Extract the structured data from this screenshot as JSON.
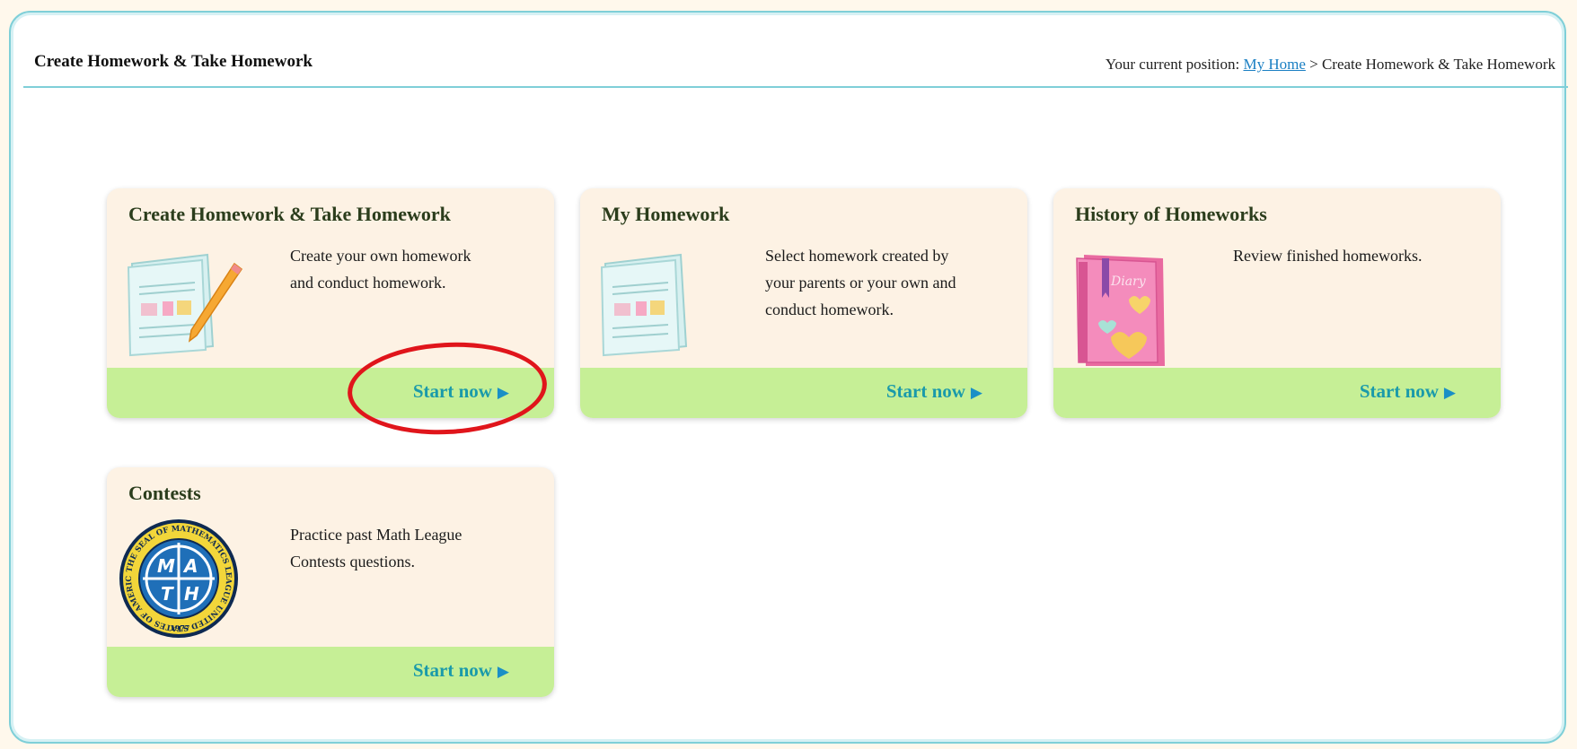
{
  "header": {
    "title": "Create Homework & Take Homework",
    "breadcrumb_prefix": "Your current position:",
    "breadcrumb_link": "My Home",
    "breadcrumb_separator": ">",
    "breadcrumb_current": "Create Homework & Take Homework"
  },
  "cards": [
    {
      "title": "Create Homework & Take Homework",
      "desc_line1": "Create your own homework",
      "desc_line2": "and conduct homework.",
      "button": "Start now",
      "icon": "homework-sheet-with-pencil-icon"
    },
    {
      "title": "My Homework",
      "desc_line1": "Select homework created by",
      "desc_line2": "your parents or your own and",
      "desc_line3": "conduct homework.",
      "button": "Start now",
      "icon": "homework-sheet-icon"
    },
    {
      "title": "History of Homeworks",
      "desc_line1": "Review finished homeworks.",
      "button": "Start now",
      "icon": "diary-book-icon",
      "diary_label": "Diary"
    },
    {
      "title": "Contests",
      "desc_line1": "Practice past Math League",
      "desc_line2": "Contests questions.",
      "button": "Start now",
      "icon": "math-league-seal-icon",
      "seal_letters": [
        "M",
        "A",
        "T",
        "H"
      ],
      "seal_ring_text": "THE SEAL OF MATHEMATICS LEAGUE UNITED STATES OF AMERICA",
      "seal_year": "1977"
    }
  ],
  "colors": {
    "card_bg": "#fdf2e4",
    "footer_green": "#c6ef96",
    "button_text": "#1a9aaa",
    "frame_border": "#7fcfd8",
    "highlight_red": "#e0151b"
  }
}
